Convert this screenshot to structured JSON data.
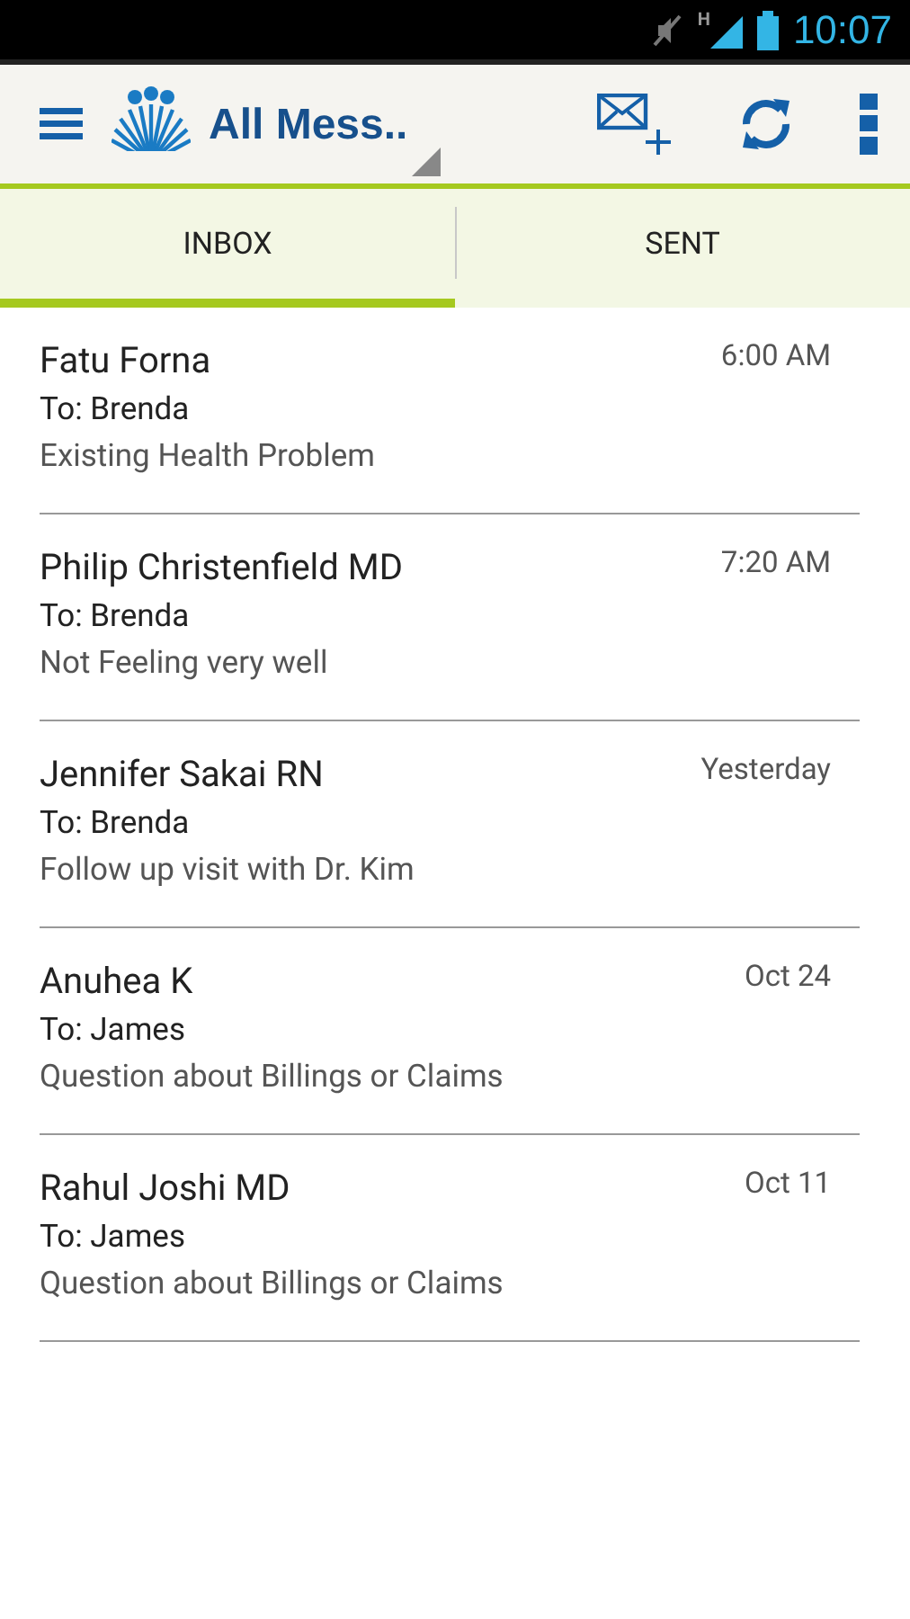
{
  "status_bar": {
    "network": "H",
    "time": "10:07"
  },
  "app_bar": {
    "title": "All Mess.."
  },
  "tabs": [
    {
      "label": "INBOX",
      "selected": true
    },
    {
      "label": "SENT",
      "selected": false
    }
  ],
  "messages": [
    {
      "sender": "Fatu Forna",
      "time": "6:00 AM",
      "to": "To: Brenda",
      "subject": "Existing Health Problem"
    },
    {
      "sender": "Philip Christenfield MD",
      "time": "7:20 AM",
      "to": "To: Brenda",
      "subject": "Not Feeling very well"
    },
    {
      "sender": "Jennifer Sakai RN",
      "time": "Yesterday",
      "to": "To: Brenda",
      "subject": "Follow up visit with Dr. Kim"
    },
    {
      "sender": "Anuhea K",
      "time": "Oct 24",
      "to": "To: James",
      "subject": "Question about Billings or Claims"
    },
    {
      "sender": "Rahul Joshi MD",
      "time": "Oct 11",
      "to": "To: James",
      "subject": "Question about Billings or Claims"
    }
  ]
}
